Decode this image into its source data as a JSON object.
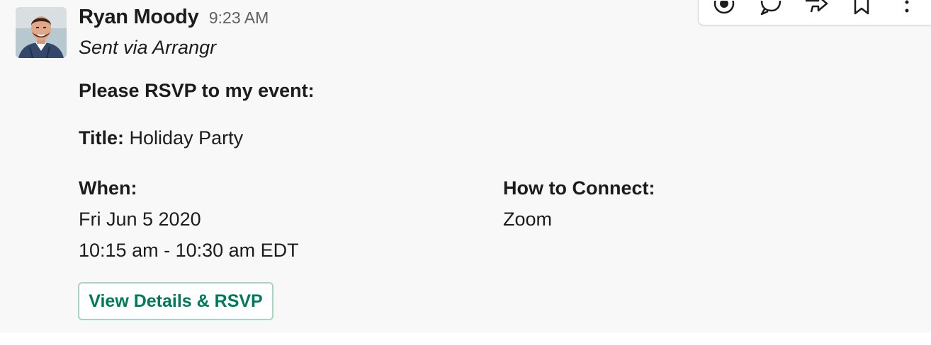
{
  "message": {
    "sender": "Ryan Moody",
    "time": "9:23 AM",
    "via": "Sent via Arrangr",
    "heading": "Please RSVP to my event:",
    "title_label": "Title:",
    "title_value": "Holiday Party",
    "when_label": "When:",
    "when_date": "Fri Jun 5 2020",
    "when_time": "10:15 am - 10:30 am EDT",
    "connect_label": "How to Connect:",
    "connect_value": "Zoom",
    "button_label": "View Details & RSVP"
  },
  "toolbar": {
    "icons": [
      "add-reaction-icon",
      "reply-in-thread-icon",
      "share-message-icon",
      "save-bookmark-icon",
      "more-actions-icon"
    ]
  },
  "colors": {
    "button_text": "#007a5a",
    "button_border": "#a9d3c1",
    "message_bg": "#f8f8f8",
    "timestamp": "#616061"
  }
}
